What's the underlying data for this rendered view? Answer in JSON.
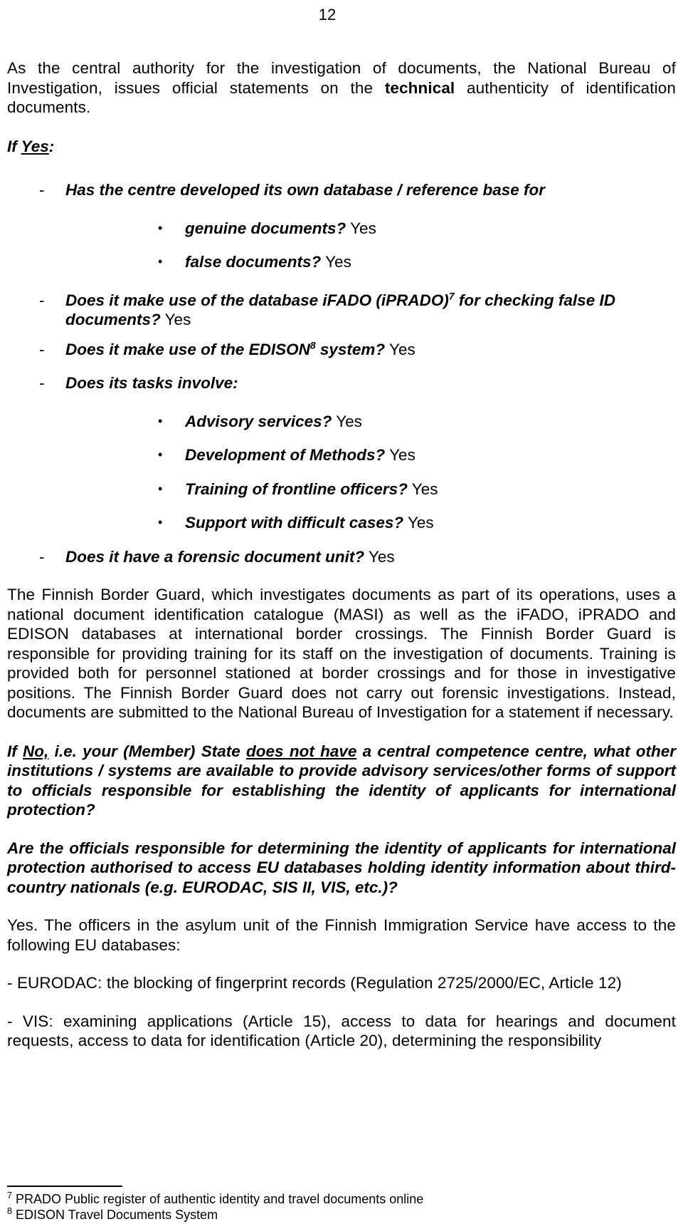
{
  "page": {
    "number": "12"
  },
  "intro": {
    "part1": "As the central authority for the investigation of documents, the National Bureau of Investigation, issues official statements on the ",
    "bold": "technical",
    "part2": " authenticity of identification documents."
  },
  "if_yes": {
    "prefix": "If ",
    "underlined": "Yes",
    "suffix": ":"
  },
  "questions": [
    {
      "marker": "-",
      "level": "dash",
      "text": "Has the centre developed its own database / reference base for",
      "answer": ""
    },
    {
      "marker": "•",
      "level": "bullet",
      "text": "genuine documents?",
      "answer": " Yes"
    },
    {
      "marker": "•",
      "level": "bullet",
      "text": "false documents?",
      "answer": " Yes"
    },
    {
      "marker": "-",
      "level": "dash",
      "text_before_sup": "Does it make use of the database iFADO (iPRADO)",
      "sup": "7",
      "text_after_sup": " for checking false ID documents?",
      "answer": " Yes"
    },
    {
      "marker": "-",
      "level": "dash",
      "text_before_sup": "Does it make use of the EDISON",
      "sup": "8",
      "text_after_sup": " system?",
      "answer": " Yes"
    },
    {
      "marker": "-",
      "level": "dash",
      "text": "Does its tasks involve:",
      "answer": ""
    },
    {
      "marker": "•",
      "level": "bullet",
      "text": "Advisory services?",
      "answer": " Yes"
    },
    {
      "marker": "•",
      "level": "bullet",
      "text": "Development of Methods?",
      "answer": " Yes"
    },
    {
      "marker": "•",
      "level": "bullet",
      "text": "Training of frontline officers?",
      "answer": " Yes"
    },
    {
      "marker": "•",
      "level": "bullet",
      "text": "Support with difficult cases?",
      "answer": " Yes"
    },
    {
      "marker": "-",
      "level": "dash",
      "text": "Does it have a forensic document unit?",
      "answer": " Yes"
    }
  ],
  "border_guard_paragraph": "The Finnish Border Guard, which investigates documents as part of its operations, uses a national document identification catalogue (MASI) as well as the iFADO, iPRADO and EDISON databases at international border crossings. The Finnish Border Guard is responsible for providing training for its staff on the investigation of documents. Training is provided both for personnel stationed at border crossings and for those in investigative positions. The Finnish Border Guard does not carry out forensic investigations. Instead, documents are submitted to the National Bureau of Investigation for a statement if necessary.",
  "if_no": {
    "part1": "If ",
    "underlined1": "No,",
    "part2": " i.e. your (Member) State ",
    "underlined2": "does not have",
    "part3": " a central competence centre, what other institutions / systems are available to provide advisory services/other forms of support to officials responsible for establishing the identity of applicants for international protection?"
  },
  "eu_databases_question": "Are the officials responsible for determining the identity of applicants for international protection authorised to access EU databases holding identity information about third-country nationals (e.g. EURODAC, SIS II, VIS, etc.)?",
  "eu_databases_answer": "Yes. The officers in the asylum unit of the Finnish Immigration Service have access to the following EU databases:",
  "database_items": [
    "- EURODAC: the blocking of fingerprint records (Regulation 2725/2000/EC, Article 12)",
    "- VIS: examining applications (Article 15), access to data for hearings and document requests, access to data for identification (Article 20), determining the responsibility"
  ],
  "footnotes": [
    {
      "marker": "7",
      "text": " PRADO Public register of authentic identity and travel documents online"
    },
    {
      "marker": "8",
      "text": " EDISON Travel Documents System"
    }
  ]
}
